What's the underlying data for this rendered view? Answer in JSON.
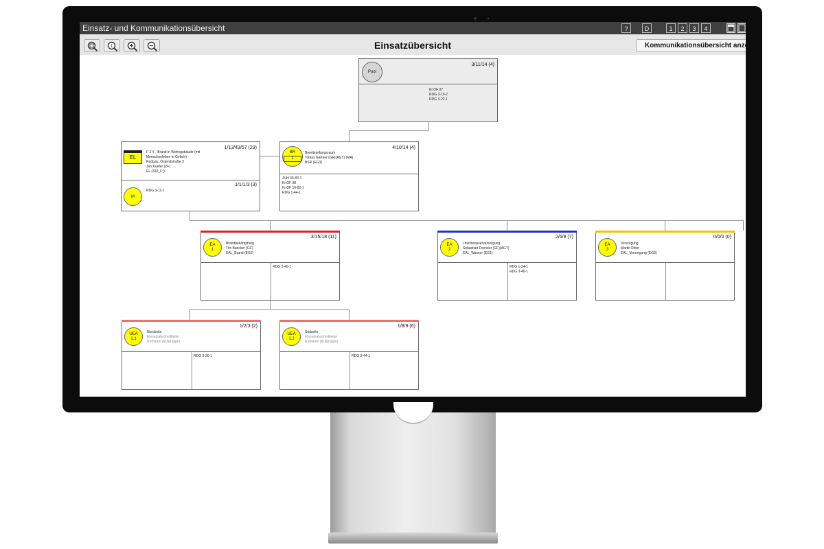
{
  "window": {
    "title": "Einsatz- und Kommunikationsübersicht",
    "help_label": "?",
    "d_label": "D",
    "layout_buttons": [
      "1",
      "2",
      "3",
      "4"
    ]
  },
  "toolbar": {
    "zoom_buttons": [
      "zoom-fit-icon",
      "zoom-reset-icon",
      "zoom-in-icon",
      "zoom-out-icon"
    ],
    "page_title": "Einsatzübersicht",
    "comm_button_label": "Kommunikationsübersicht anzeigen"
  },
  "colors": {
    "red": "#e02020",
    "blue": "#1f32c8",
    "yellow": "#f2c200",
    "pink": "#f07070",
    "unit_yellow": "#ffff00"
  },
  "units": {
    "pool": {
      "label": "Pool",
      "counts": "3/11/14 (4)",
      "resources": [
        "Kr.OF 07",
        "RDG 3-19-2",
        "RDG 3-22-1"
      ]
    },
    "el": {
      "badge": "EL",
      "counts": "1/13/43/57 (29)",
      "info": [
        "F 2 Y - Brand in Wohngebäude (mit",
        "Menschenleben in Gefahr)",
        "Rodgau, Ostendstraße 3",
        "Jan Kuefer (ZF)",
        "EL (310_F°)"
      ],
      "sub_counts": "1/1/1/3 (3)",
      "sub_badge": "M",
      "sub_resources": [
        "RDG 3-11-1"
      ]
    },
    "br": {
      "badge_line1": "BR",
      "badge_line2": "1",
      "counts": "4/10/14 (4)",
      "info": [
        "Bereitstellungsraum",
        "Tobias Gärtner (GF)(AGT) (MA)",
        "BSR (EG3)"
      ],
      "resources": [
        "JUH 33-83-1",
        "Kr.OF 08",
        "Kr.OF 10-82-1",
        "RDG 1-44-1"
      ]
    },
    "ea1": {
      "badge_line1": "EA",
      "badge_line2": "1",
      "counts": "3/15/18 (11)",
      "info": [
        "Brandbekämpfung",
        "Tim Baecker (GF)",
        "EAL_Brand (EG2)"
      ],
      "resources": [
        "RDG 2-40-1"
      ]
    },
    "ea2": {
      "badge_line1": "EA",
      "badge_line2": "2",
      "counts": "2/6/8 (7)",
      "info": [
        "Löschwasserversorgung",
        "Sebastian Foerster (GF)(AGT)",
        "EAL_Wasser (EG1)"
      ],
      "resources": [
        "RDG 1-24-1",
        "RDG 3-40-1"
      ]
    },
    "ea3": {
      "badge_line1": "EA",
      "badge_line2": "3",
      "counts": "0/0/0 (0)",
      "info": [
        "Versorgung",
        "Martin Ritter",
        "EAL_Versorgung (EG3)"
      ],
      "resources": []
    },
    "uea11": {
      "badge_line1": "UEA",
      "badge_line2": "1.1",
      "counts": "1/2/3 (2)",
      "info": [
        "Nordseite",
        "Einsatzabschnittleiter",
        "Rufname (Rufgruppe)"
      ],
      "resources": [
        "RDG 3-30-1"
      ]
    },
    "uea12": {
      "badge_line1": "UEA",
      "badge_line2": "1.2",
      "counts": "1/8/9 (6)",
      "info": [
        "Südseite",
        "Einsatzabschnittleiter",
        "Rufname (Rufgruppe)"
      ],
      "resources": [
        "RDG 3-44-1"
      ]
    }
  }
}
